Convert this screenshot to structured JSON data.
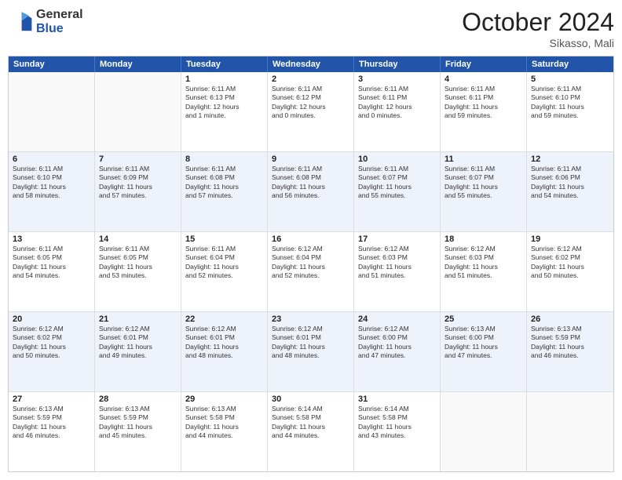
{
  "header": {
    "logo_general": "General",
    "logo_blue": "Blue",
    "month_title": "October 2024",
    "location": "Sikasso, Mali"
  },
  "days_of_week": [
    "Sunday",
    "Monday",
    "Tuesday",
    "Wednesday",
    "Thursday",
    "Friday",
    "Saturday"
  ],
  "rows": [
    {
      "alt": false,
      "cells": [
        {
          "day": "",
          "empty": true,
          "info": ""
        },
        {
          "day": "",
          "empty": true,
          "info": ""
        },
        {
          "day": "1",
          "empty": false,
          "info": "Sunrise: 6:11 AM\nSunset: 6:13 PM\nDaylight: 12 hours\nand 1 minute."
        },
        {
          "day": "2",
          "empty": false,
          "info": "Sunrise: 6:11 AM\nSunset: 6:12 PM\nDaylight: 12 hours\nand 0 minutes."
        },
        {
          "day": "3",
          "empty": false,
          "info": "Sunrise: 6:11 AM\nSunset: 6:11 PM\nDaylight: 12 hours\nand 0 minutes."
        },
        {
          "day": "4",
          "empty": false,
          "info": "Sunrise: 6:11 AM\nSunset: 6:11 PM\nDaylight: 11 hours\nand 59 minutes."
        },
        {
          "day": "5",
          "empty": false,
          "info": "Sunrise: 6:11 AM\nSunset: 6:10 PM\nDaylight: 11 hours\nand 59 minutes."
        }
      ]
    },
    {
      "alt": true,
      "cells": [
        {
          "day": "6",
          "empty": false,
          "info": "Sunrise: 6:11 AM\nSunset: 6:10 PM\nDaylight: 11 hours\nand 58 minutes."
        },
        {
          "day": "7",
          "empty": false,
          "info": "Sunrise: 6:11 AM\nSunset: 6:09 PM\nDaylight: 11 hours\nand 57 minutes."
        },
        {
          "day": "8",
          "empty": false,
          "info": "Sunrise: 6:11 AM\nSunset: 6:08 PM\nDaylight: 11 hours\nand 57 minutes."
        },
        {
          "day": "9",
          "empty": false,
          "info": "Sunrise: 6:11 AM\nSunset: 6:08 PM\nDaylight: 11 hours\nand 56 minutes."
        },
        {
          "day": "10",
          "empty": false,
          "info": "Sunrise: 6:11 AM\nSunset: 6:07 PM\nDaylight: 11 hours\nand 55 minutes."
        },
        {
          "day": "11",
          "empty": false,
          "info": "Sunrise: 6:11 AM\nSunset: 6:07 PM\nDaylight: 11 hours\nand 55 minutes."
        },
        {
          "day": "12",
          "empty": false,
          "info": "Sunrise: 6:11 AM\nSunset: 6:06 PM\nDaylight: 11 hours\nand 54 minutes."
        }
      ]
    },
    {
      "alt": false,
      "cells": [
        {
          "day": "13",
          "empty": false,
          "info": "Sunrise: 6:11 AM\nSunset: 6:05 PM\nDaylight: 11 hours\nand 54 minutes."
        },
        {
          "day": "14",
          "empty": false,
          "info": "Sunrise: 6:11 AM\nSunset: 6:05 PM\nDaylight: 11 hours\nand 53 minutes."
        },
        {
          "day": "15",
          "empty": false,
          "info": "Sunrise: 6:11 AM\nSunset: 6:04 PM\nDaylight: 11 hours\nand 52 minutes."
        },
        {
          "day": "16",
          "empty": false,
          "info": "Sunrise: 6:12 AM\nSunset: 6:04 PM\nDaylight: 11 hours\nand 52 minutes."
        },
        {
          "day": "17",
          "empty": false,
          "info": "Sunrise: 6:12 AM\nSunset: 6:03 PM\nDaylight: 11 hours\nand 51 minutes."
        },
        {
          "day": "18",
          "empty": false,
          "info": "Sunrise: 6:12 AM\nSunset: 6:03 PM\nDaylight: 11 hours\nand 51 minutes."
        },
        {
          "day": "19",
          "empty": false,
          "info": "Sunrise: 6:12 AM\nSunset: 6:02 PM\nDaylight: 11 hours\nand 50 minutes."
        }
      ]
    },
    {
      "alt": true,
      "cells": [
        {
          "day": "20",
          "empty": false,
          "info": "Sunrise: 6:12 AM\nSunset: 6:02 PM\nDaylight: 11 hours\nand 50 minutes."
        },
        {
          "day": "21",
          "empty": false,
          "info": "Sunrise: 6:12 AM\nSunset: 6:01 PM\nDaylight: 11 hours\nand 49 minutes."
        },
        {
          "day": "22",
          "empty": false,
          "info": "Sunrise: 6:12 AM\nSunset: 6:01 PM\nDaylight: 11 hours\nand 48 minutes."
        },
        {
          "day": "23",
          "empty": false,
          "info": "Sunrise: 6:12 AM\nSunset: 6:01 PM\nDaylight: 11 hours\nand 48 minutes."
        },
        {
          "day": "24",
          "empty": false,
          "info": "Sunrise: 6:12 AM\nSunset: 6:00 PM\nDaylight: 11 hours\nand 47 minutes."
        },
        {
          "day": "25",
          "empty": false,
          "info": "Sunrise: 6:13 AM\nSunset: 6:00 PM\nDaylight: 11 hours\nand 47 minutes."
        },
        {
          "day": "26",
          "empty": false,
          "info": "Sunrise: 6:13 AM\nSunset: 5:59 PM\nDaylight: 11 hours\nand 46 minutes."
        }
      ]
    },
    {
      "alt": false,
      "cells": [
        {
          "day": "27",
          "empty": false,
          "info": "Sunrise: 6:13 AM\nSunset: 5:59 PM\nDaylight: 11 hours\nand 46 minutes."
        },
        {
          "day": "28",
          "empty": false,
          "info": "Sunrise: 6:13 AM\nSunset: 5:59 PM\nDaylight: 11 hours\nand 45 minutes."
        },
        {
          "day": "29",
          "empty": false,
          "info": "Sunrise: 6:13 AM\nSunset: 5:58 PM\nDaylight: 11 hours\nand 44 minutes."
        },
        {
          "day": "30",
          "empty": false,
          "info": "Sunrise: 6:14 AM\nSunset: 5:58 PM\nDaylight: 11 hours\nand 44 minutes."
        },
        {
          "day": "31",
          "empty": false,
          "info": "Sunrise: 6:14 AM\nSunset: 5:58 PM\nDaylight: 11 hours\nand 43 minutes."
        },
        {
          "day": "",
          "empty": true,
          "info": ""
        },
        {
          "day": "",
          "empty": true,
          "info": ""
        }
      ]
    }
  ]
}
